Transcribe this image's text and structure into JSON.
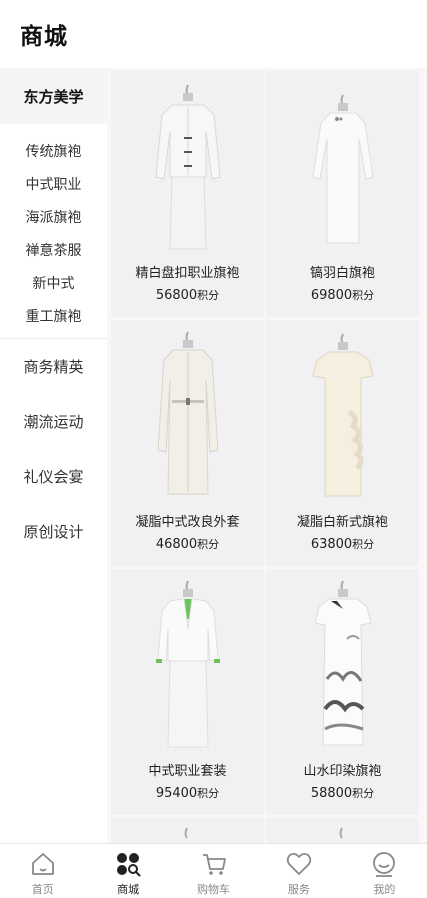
{
  "header": {
    "title": "商城"
  },
  "sidebar": {
    "group_title": "东方美学",
    "sub_items": [
      "传统旗袍",
      "中式职业",
      "海派旗袍",
      "禅意茶服",
      "新中式",
      "重工旗袍"
    ],
    "categories": [
      "商务精英",
      "潮流运动",
      "礼仪会宴",
      "原创设计"
    ]
  },
  "products": [
    {
      "name": "精白盘扣职业旗袍",
      "price": "56800",
      "unit": "积分",
      "image": "white-jacket-qipao-set"
    },
    {
      "name": "镐羽白旗袍",
      "price": "69800",
      "unit": "积分",
      "image": "white-long-qipao"
    },
    {
      "name": "凝脂中式改良外套",
      "price": "46800",
      "unit": "积分",
      "image": "cream-long-coat"
    },
    {
      "name": "凝脂白新式旗袍",
      "price": "63800",
      "unit": "积分",
      "image": "cream-ruffle-qipao"
    },
    {
      "name": "中式职业套装",
      "price": "95400",
      "unit": "积分",
      "image": "white-suit-green-shirt"
    },
    {
      "name": "山水印染旗袍",
      "price": "58800",
      "unit": "积分",
      "image": "ink-landscape-qipao"
    }
  ],
  "tabbar": {
    "items": [
      {
        "label": "首页",
        "icon": "home-icon"
      },
      {
        "label": "商城",
        "icon": "mall-icon"
      },
      {
        "label": "购物车",
        "icon": "cart-icon"
      },
      {
        "label": "服务",
        "icon": "heart-icon"
      },
      {
        "label": "我的",
        "icon": "profile-icon"
      }
    ],
    "active_index": 1
  },
  "colors": {
    "accent": "#222222",
    "inactive": "#888888",
    "card_bg": "#f1f1f3",
    "sidebar_active_bg": "#f4f4f5"
  }
}
